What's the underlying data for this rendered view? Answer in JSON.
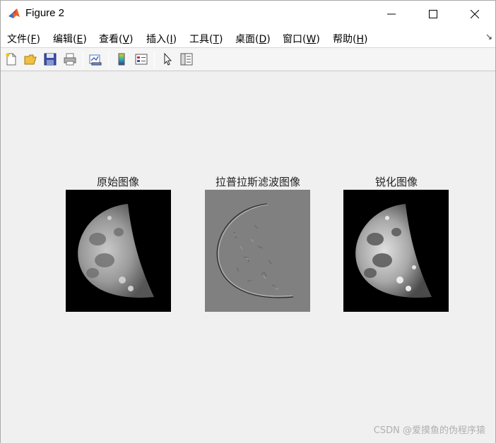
{
  "window": {
    "title": "Figure 2"
  },
  "menu": {
    "items": [
      {
        "label": "文件(",
        "acc": "F",
        "end": ")"
      },
      {
        "label": "编辑(",
        "acc": "E",
        "end": ")"
      },
      {
        "label": "查看(",
        "acc": "V",
        "end": ")"
      },
      {
        "label": "插入(",
        "acc": "I",
        "end": ")"
      },
      {
        "label": "工具(",
        "acc": "T",
        "end": ")"
      },
      {
        "label": "桌面(",
        "acc": "D",
        "end": ")"
      },
      {
        "label": "窗口(",
        "acc": "W",
        "end": ")"
      },
      {
        "label": "帮助(",
        "acc": "H",
        "end": ")"
      }
    ]
  },
  "toolbar": {
    "icons": [
      "new-figure-icon",
      "open-file-icon",
      "save-icon",
      "print-icon",
      "link-plot-icon",
      "insert-colorbar-icon",
      "insert-legend-icon",
      "edit-plot-arrow-icon",
      "property-inspector-icon"
    ]
  },
  "subplots": [
    {
      "title": "原始图像",
      "kind": "original"
    },
    {
      "title": "拉普拉斯滤波图像",
      "kind": "laplacian"
    },
    {
      "title": "锐化图像",
      "kind": "sharpened"
    }
  ],
  "watermark": "CSDN @爱摸鱼的伪程序猿",
  "colors": {
    "background": "#f0f0f0",
    "laplacian_gray": "#808080",
    "image_black": "#000000"
  }
}
